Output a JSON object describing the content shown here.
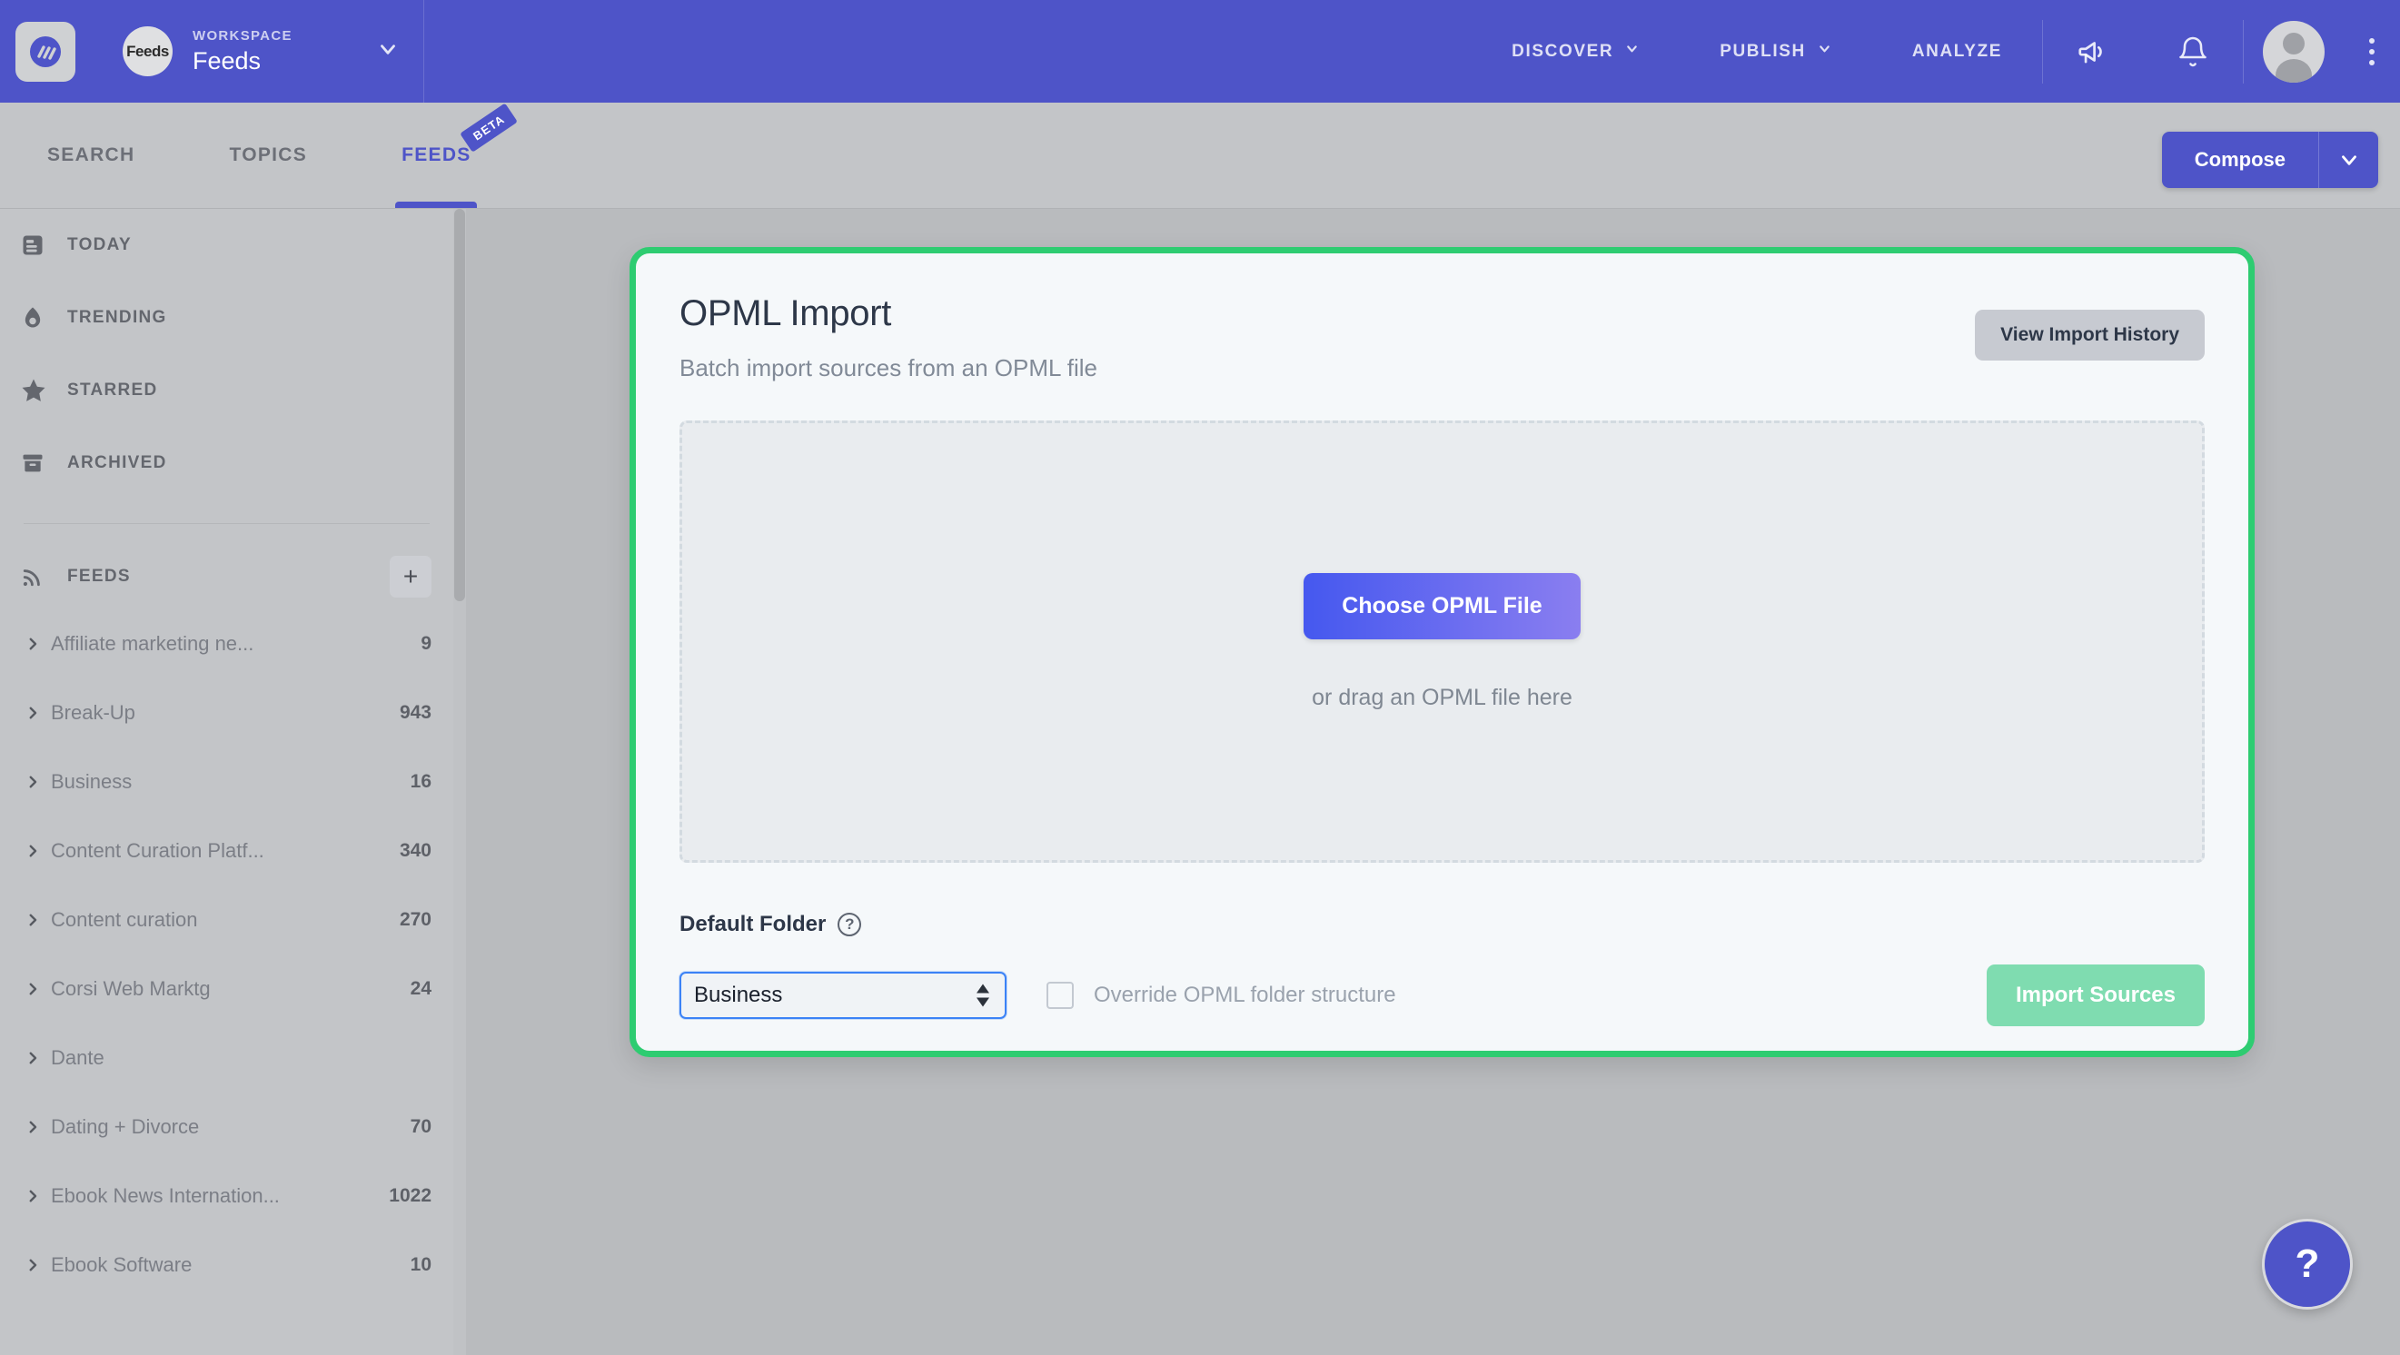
{
  "topbar": {
    "logo_icon": "app-logo-icon",
    "workspace_label": "WORKSPACE",
    "workspace_name": "Feeds",
    "workspace_avatar_text": "Feeds",
    "nav": [
      {
        "label": "DISCOVER",
        "has_caret": true
      },
      {
        "label": "PUBLISH",
        "has_caret": true
      },
      {
        "label": "ANALYZE",
        "has_caret": false
      }
    ],
    "megaphone_icon": "megaphone-icon",
    "bell_icon": "bell-icon",
    "kebab_icon": "more-vertical-icon",
    "brand_color": "#4e54c8"
  },
  "subbar": {
    "tabs": [
      {
        "label": "SEARCH",
        "active": false,
        "badge": ""
      },
      {
        "label": "TOPICS",
        "active": false,
        "badge": ""
      },
      {
        "label": "FEEDS",
        "active": true,
        "badge": "BETA"
      }
    ],
    "compose_label": "Compose"
  },
  "sidebar": {
    "nav_items": [
      {
        "label": "TODAY",
        "icon": "today-icon"
      },
      {
        "label": "TRENDING",
        "icon": "flame-icon"
      },
      {
        "label": "STARRED",
        "icon": "star-icon"
      },
      {
        "label": "ARCHIVED",
        "icon": "archive-icon"
      }
    ],
    "feeds_section_title": "FEEDS",
    "add_feed_label": "+",
    "feeds": [
      {
        "name": "Affiliate marketing ne...",
        "count": "9"
      },
      {
        "name": "Break-Up",
        "count": "943"
      },
      {
        "name": "Business",
        "count": "16"
      },
      {
        "name": "Content Curation Platf...",
        "count": "340"
      },
      {
        "name": "Content curation",
        "count": "270"
      },
      {
        "name": "Corsi Web Marktg",
        "count": "24"
      },
      {
        "name": "Dante",
        "count": ""
      },
      {
        "name": "Dating + Divorce",
        "count": "70"
      },
      {
        "name": "Ebook News Internation...",
        "count": "1022"
      },
      {
        "name": "Ebook Software",
        "count": "10"
      }
    ]
  },
  "card": {
    "title": "OPML Import",
    "subtitle": "Batch import sources from an OPML file",
    "history_button": "View Import History",
    "dropzone": {
      "choose_button": "Choose OPML File",
      "drag_hint": "or drag an OPML file here"
    },
    "default_folder_label": "Default Folder",
    "help_icon": "question-circle-icon",
    "folder_value": "Business",
    "folder_options": [
      "Business"
    ],
    "override_checkbox_label": "Override OPML folder structure",
    "override_checked": false,
    "import_button": "Import Sources",
    "border_color": "#2ecc71"
  },
  "help_fab": {
    "label": "?"
  }
}
